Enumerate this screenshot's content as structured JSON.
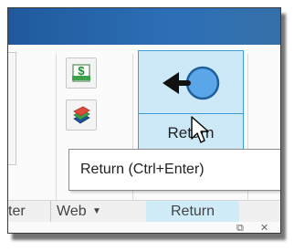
{
  "ribbon": {
    "return_button": {
      "label": "Return",
      "icon": "return-arrow-icon"
    },
    "small_buttons": [
      {
        "icon": "money-document-icon"
      },
      {
        "icon": "layers-stack-icon"
      }
    ],
    "tooltip": "Return (Ctrl+Enter)",
    "panels": {
      "partial": "ter",
      "web": "Web",
      "web_dropdown_icon": "chevron-down-icon",
      "return": "Return"
    }
  },
  "colors": {
    "titlebar": "#2c6fb7",
    "return_bg": "#cde8f7",
    "return_border": "#3c9fd8",
    "arrow_circle": "#5aa6e8"
  }
}
